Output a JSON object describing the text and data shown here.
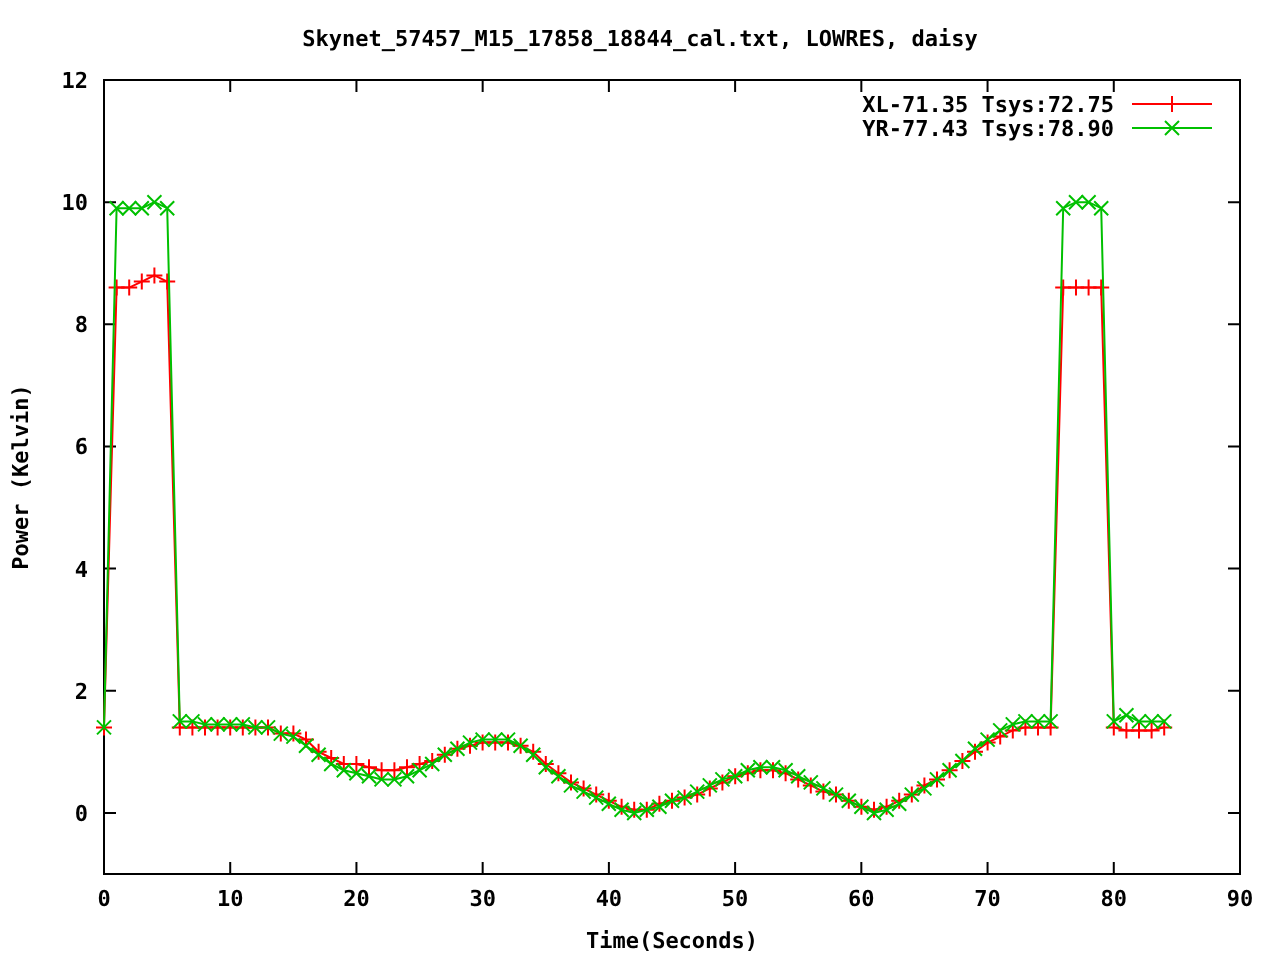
{
  "chart_data": {
    "type": "line",
    "title": "Skynet_57457_M15_17858_18844_cal.txt, LOWRES, daisy",
    "xlabel": "Time(Seconds)",
    "ylabel": "Power (Kelvin)",
    "x": [
      0,
      1,
      2,
      3,
      4,
      5,
      6,
      7,
      8,
      9,
      10,
      11,
      12,
      13,
      14,
      15,
      16,
      17,
      18,
      19,
      20,
      21,
      22,
      23,
      24,
      25,
      26,
      27,
      28,
      29,
      30,
      31,
      32,
      33,
      34,
      35,
      36,
      37,
      38,
      39,
      40,
      41,
      42,
      43,
      44,
      45,
      46,
      47,
      48,
      49,
      50,
      51,
      52,
      53,
      54,
      55,
      56,
      57,
      58,
      59,
      60,
      61,
      62,
      63,
      64,
      65,
      66,
      67,
      68,
      69,
      70,
      71,
      72,
      73,
      74,
      75,
      76,
      77,
      78,
      79,
      80,
      81,
      82,
      83,
      84
    ],
    "series": [
      {
        "name": "XL-71.35 Tsys:72.75",
        "color": "#ff0000",
        "values": [
          1.4,
          8.6,
          8.6,
          8.7,
          8.8,
          8.7,
          1.4,
          1.4,
          1.4,
          1.4,
          1.4,
          1.4,
          1.4,
          1.4,
          1.3,
          1.3,
          1.2,
          1.0,
          0.9,
          0.8,
          0.8,
          0.75,
          0.7,
          0.7,
          0.75,
          0.8,
          0.85,
          0.95,
          1.05,
          1.1,
          1.15,
          1.15,
          1.15,
          1.1,
          1.0,
          0.8,
          0.65,
          0.5,
          0.4,
          0.3,
          0.2,
          0.1,
          0.05,
          0.05,
          0.15,
          0.2,
          0.25,
          0.3,
          0.4,
          0.5,
          0.6,
          0.65,
          0.7,
          0.7,
          0.65,
          0.55,
          0.45,
          0.35,
          0.3,
          0.2,
          0.1,
          0.05,
          0.1,
          0.2,
          0.3,
          0.45,
          0.55,
          0.7,
          0.85,
          1.0,
          1.15,
          1.25,
          1.35,
          1.4,
          1.4,
          1.4,
          8.6,
          8.6,
          8.6,
          8.6,
          1.4,
          1.35,
          1.35,
          1.35,
          1.4
        ]
      },
      {
        "name": "YR-77.43 Tsys:78.90",
        "color": "#00c000",
        "values": [
          1.4,
          9.9,
          9.9,
          9.9,
          10.0,
          9.9,
          1.5,
          1.5,
          1.45,
          1.45,
          1.45,
          1.45,
          1.4,
          1.4,
          1.3,
          1.25,
          1.1,
          0.95,
          0.8,
          0.7,
          0.65,
          0.6,
          0.55,
          0.55,
          0.6,
          0.7,
          0.8,
          0.95,
          1.05,
          1.15,
          1.2,
          1.2,
          1.2,
          1.1,
          0.95,
          0.75,
          0.6,
          0.45,
          0.35,
          0.25,
          0.15,
          0.05,
          0.0,
          0.05,
          0.1,
          0.2,
          0.25,
          0.35,
          0.45,
          0.55,
          0.6,
          0.7,
          0.75,
          0.75,
          0.7,
          0.6,
          0.5,
          0.4,
          0.3,
          0.2,
          0.1,
          0.0,
          0.05,
          0.15,
          0.3,
          0.4,
          0.55,
          0.7,
          0.85,
          1.05,
          1.2,
          1.35,
          1.45,
          1.5,
          1.5,
          1.5,
          9.9,
          10.0,
          10.0,
          9.9,
          1.5,
          1.6,
          1.5,
          1.5,
          1.5
        ]
      }
    ],
    "xlim": [
      0,
      90
    ],
    "ylim": [
      -1,
      12
    ],
    "xticks": [
      0,
      10,
      20,
      30,
      40,
      50,
      60,
      70,
      80,
      90
    ],
    "yticks": [
      0,
      2,
      4,
      6,
      8,
      10,
      12
    ],
    "legend": true
  }
}
